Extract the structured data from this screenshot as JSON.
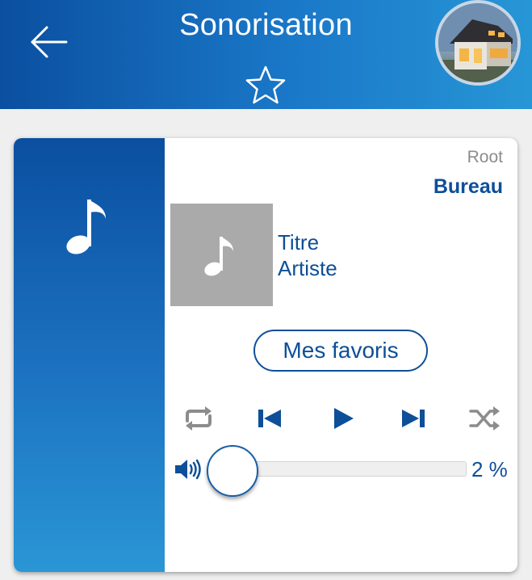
{
  "header": {
    "title": "Sonorisation",
    "back_icon": "arrow-left-icon",
    "favorite_icon": "star-outline-icon",
    "avatar_icon": "house-photo"
  },
  "player": {
    "source_label": "Root",
    "room_name": "Bureau",
    "side_icon": "music-note-icon",
    "album_art_icon": "music-note-icon",
    "track_title": "Titre",
    "track_artist": "Artiste",
    "favorites_button": "Mes favoris",
    "controls": [
      "repeat-icon",
      "previous-icon",
      "play-icon",
      "next-icon",
      "shuffle-icon"
    ],
    "volume": {
      "icon": "speaker-icon",
      "level_percent": 2,
      "label": "2 %"
    }
  },
  "colors": {
    "header_gradient_start": "#0b4fa0",
    "header_gradient_end": "#2796d6",
    "accent": "#0d4f98",
    "inactive_control": "#8c8c8c",
    "album_placeholder": "#aaaaaa",
    "background": "#efefef"
  }
}
